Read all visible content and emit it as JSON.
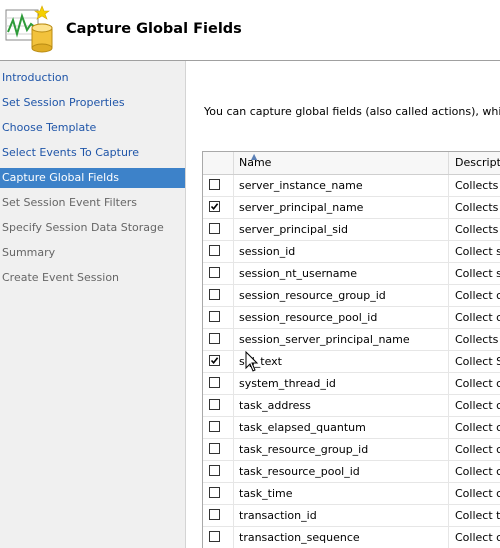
{
  "window": {
    "title": "Capture Global Fields"
  },
  "sidebar": {
    "items": [
      {
        "label": "Introduction",
        "state": "link"
      },
      {
        "label": "Set Session Properties",
        "state": "link"
      },
      {
        "label": "Choose Template",
        "state": "link"
      },
      {
        "label": "Select Events To Capture",
        "state": "link"
      },
      {
        "label": "Capture Global Fields",
        "state": "active"
      },
      {
        "label": "Set Session Event Filters",
        "state": "disabled"
      },
      {
        "label": "Specify Session Data Storage",
        "state": "disabled"
      },
      {
        "label": "Summary",
        "state": "disabled"
      },
      {
        "label": "Create Event Session",
        "state": "disabled"
      }
    ]
  },
  "main": {
    "intro": "You can capture global fields (also called actions), which are co",
    "grid": {
      "columns": {
        "name": "Name",
        "description": "Descripti"
      },
      "rows": [
        {
          "checked": false,
          "name": "server_instance_name",
          "description": "Collects th"
        },
        {
          "checked": true,
          "name": "server_principal_name",
          "description": "Collects th"
        },
        {
          "checked": false,
          "name": "server_principal_sid",
          "description": "Collects th"
        },
        {
          "checked": false,
          "name": "session_id",
          "description": "Collect ses"
        },
        {
          "checked": false,
          "name": "session_nt_username",
          "description": "Collect ses"
        },
        {
          "checked": false,
          "name": "session_resource_group_id",
          "description": "Collect cu"
        },
        {
          "checked": false,
          "name": "session_resource_pool_id",
          "description": "Collect cu"
        },
        {
          "checked": false,
          "name": "session_server_principal_name",
          "description": "Collects th"
        },
        {
          "checked": true,
          "name": "sql_text",
          "description": "Collect SQ"
        },
        {
          "checked": false,
          "name": "system_thread_id",
          "description": "Collect cu"
        },
        {
          "checked": false,
          "name": "task_address",
          "description": "Collect cu"
        },
        {
          "checked": false,
          "name": "task_elapsed_quantum",
          "description": "Collect cu"
        },
        {
          "checked": false,
          "name": "task_resource_group_id",
          "description": "Collect cu"
        },
        {
          "checked": false,
          "name": "task_resource_pool_id",
          "description": "Collect cu"
        },
        {
          "checked": false,
          "name": "task_time",
          "description": "Collect cu"
        },
        {
          "checked": false,
          "name": "transaction_id",
          "description": "Collect tra"
        },
        {
          "checked": false,
          "name": "transaction_sequence",
          "description": "Collect cu"
        }
      ]
    }
  },
  "colors": {
    "active_bg": "#3d82c9",
    "link": "#1f55a8",
    "disabled": "#666666"
  },
  "icons": {
    "logo": "chart-database-icon",
    "sort": "sort-ascending-icon",
    "cursor": "mouse-pointer-icon",
    "check": "checkmark-icon"
  }
}
